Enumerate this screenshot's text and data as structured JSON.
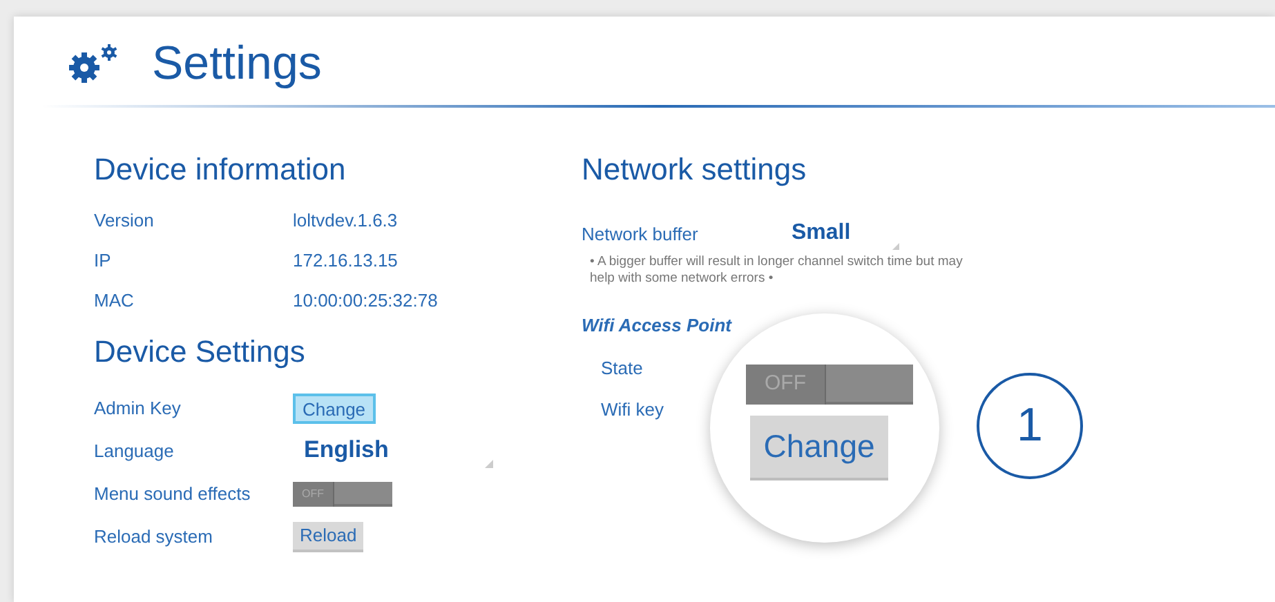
{
  "header": {
    "title": "Settings"
  },
  "device_information": {
    "title": "Device information",
    "rows": [
      {
        "label": "Version",
        "value": "loltvdev.1.6.3"
      },
      {
        "label": "IP",
        "value": "172.16.13.15"
      },
      {
        "label": "MAC",
        "value": "10:00:00:25:32:78"
      }
    ]
  },
  "device_settings": {
    "title": "Device Settings",
    "rows": [
      {
        "kind": "button",
        "label": "Admin Key",
        "button": "Change",
        "selected": true
      },
      {
        "kind": "select",
        "label": "Language",
        "value": "English"
      },
      {
        "kind": "toggle",
        "label": "Menu sound effects",
        "toggle": "OFF",
        "on": false
      },
      {
        "kind": "button",
        "label": "Reload system",
        "button": "Reload",
        "selected": false
      }
    ]
  },
  "network_settings": {
    "title": "Network settings",
    "buffer": {
      "label": "Network buffer",
      "value": "Small"
    },
    "note": "• A bigger buffer will result in longer channel switch time but may help with some network errors •",
    "wifi": {
      "title": "Wifi Access Point",
      "state_label": "State",
      "key_label": "Wifi key",
      "state": {
        "text": "OFF",
        "on": false
      },
      "key_button": "Change"
    }
  },
  "callout": "1"
}
